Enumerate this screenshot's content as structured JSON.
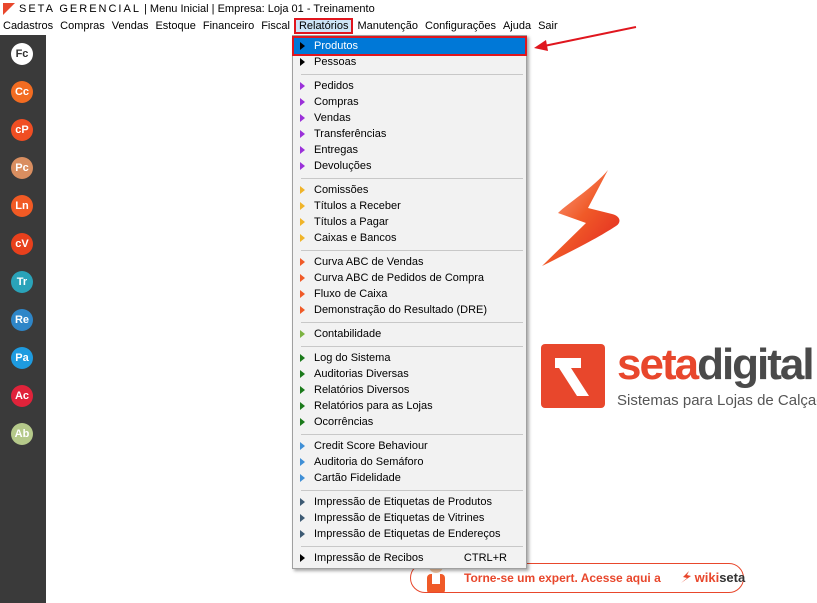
{
  "window": {
    "brand": "SETA GERENCIAL",
    "title_rest": " | Menu Inicial | Empresa: Loja 01 - Treinamento"
  },
  "menubar": [
    {
      "id": "cadastros",
      "label": "Cadastros"
    },
    {
      "id": "compras",
      "label": "Compras"
    },
    {
      "id": "vendas",
      "label": "Vendas"
    },
    {
      "id": "estoque",
      "label": "Estoque"
    },
    {
      "id": "financeiro",
      "label": "Financeiro"
    },
    {
      "id": "fiscal",
      "label": "Fiscal"
    },
    {
      "id": "relatorios",
      "label": "Relatórios",
      "active": true
    },
    {
      "id": "manutencao",
      "label": "Manutenção"
    },
    {
      "id": "configuracoes",
      "label": "Configurações"
    },
    {
      "id": "ajuda",
      "label": "Ajuda"
    },
    {
      "id": "sair",
      "label": "Sair"
    }
  ],
  "sidebar": [
    {
      "code": "Fc",
      "color": "#ffffff",
      "text_color": "#333333"
    },
    {
      "code": "Cc",
      "color": "#f36c21",
      "text_color": "#ffffff"
    },
    {
      "code": "cP",
      "color": "#f04e23",
      "text_color": "#ffffff"
    },
    {
      "code": "Pc",
      "color": "#d98e60",
      "text_color": "#ffffff"
    },
    {
      "code": "Ln",
      "color": "#f15a24",
      "text_color": "#ffffff"
    },
    {
      "code": "cV",
      "color": "#e8401c",
      "text_color": "#ffffff"
    },
    {
      "code": "Tr",
      "color": "#2aa3b9",
      "text_color": "#ffffff"
    },
    {
      "code": "Re",
      "color": "#2e86c8",
      "text_color": "#ffffff"
    },
    {
      "code": "Pa",
      "color": "#1e9be0",
      "text_color": "#ffffff"
    },
    {
      "code": "Ac",
      "color": "#e0233a",
      "text_color": "#ffffff"
    },
    {
      "code": "Ab",
      "color": "#b5c98a",
      "text_color": "#ffffff"
    }
  ],
  "dropdown": {
    "groups": [
      {
        "color": "#000000",
        "items": [
          {
            "label": "Produtos",
            "highlighted": true
          },
          {
            "label": "Pessoas"
          }
        ]
      },
      {
        "color": "#9b30d9",
        "items": [
          {
            "label": "Pedidos"
          },
          {
            "label": "Compras"
          },
          {
            "label": "Vendas"
          },
          {
            "label": "Transferências"
          },
          {
            "label": "Entregas"
          },
          {
            "label": "Devoluções"
          }
        ]
      },
      {
        "color": "#f0b429",
        "items": [
          {
            "label": "Comissões"
          },
          {
            "label": "Títulos a Receber"
          },
          {
            "label": "Títulos a Pagar"
          },
          {
            "label": "Caixas e Bancos"
          }
        ]
      },
      {
        "color": "#f05a28",
        "items": [
          {
            "label": "Curva ABC de Vendas"
          },
          {
            "label": "Curva ABC de Pedidos de Compra"
          },
          {
            "label": "Fluxo de Caixa"
          },
          {
            "label": "Demonstração do Resultado (DRE)"
          }
        ]
      },
      {
        "color": "#7cb342",
        "items": [
          {
            "label": "Contabilidade"
          }
        ]
      },
      {
        "color": "#1b7a1b",
        "items": [
          {
            "label": "Log do Sistema"
          },
          {
            "label": "Auditorias Diversas"
          },
          {
            "label": "Relatórios Diversos"
          },
          {
            "label": "Relatórios para as Lojas"
          },
          {
            "label": "Ocorrências"
          }
        ]
      },
      {
        "color": "#3f8fd6",
        "items": [
          {
            "label": "Credit Score Behaviour"
          },
          {
            "label": "Auditoria do Semáforo"
          },
          {
            "label": "Cartão Fidelidade"
          }
        ]
      },
      {
        "color": "#3d5a73",
        "items": [
          {
            "label": "Impressão de Etiquetas de Produtos"
          },
          {
            "label": "Impressão de Etiquetas de Vitrines"
          },
          {
            "label": "Impressão de Etiquetas de Endereços"
          }
        ]
      },
      {
        "color": "#000000",
        "items": [
          {
            "label": "Impressão de Recibos",
            "shortcut": "CTRL+R"
          }
        ]
      }
    ]
  },
  "logo": {
    "word_seta": "seta",
    "word_digital": "digital",
    "tagline": "Sistemas para Lojas de Calçados",
    "color_seta": "#e8472c",
    "color_digital": "#4a4a4a"
  },
  "banner": {
    "text": "Torne-se um expert. Acesse aqui a",
    "brand_wiki": "wiki",
    "brand_seta": "seta"
  }
}
